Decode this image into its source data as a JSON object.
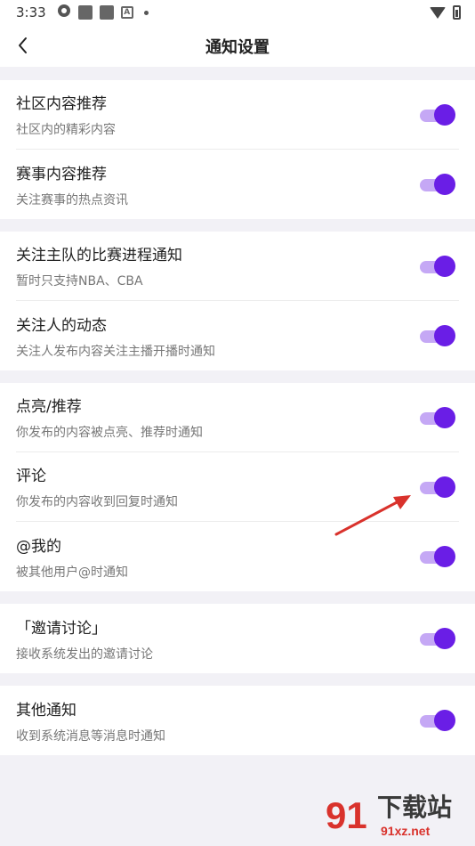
{
  "status_bar": {
    "time": "3:33"
  },
  "header": {
    "title": "通知设置"
  },
  "groups": [
    {
      "items": [
        {
          "title": "社区内容推荐",
          "subtitle": "社区内的精彩内容",
          "enabled": true
        },
        {
          "title": "赛事内容推荐",
          "subtitle": "关注赛事的热点资讯",
          "enabled": true
        }
      ]
    },
    {
      "items": [
        {
          "title": "关注主队的比赛进程通知",
          "subtitle": "暂时只支持NBA、CBA",
          "enabled": true
        },
        {
          "title": "关注人的动态",
          "subtitle": "关注人发布内容关注主播开播时通知",
          "enabled": true
        }
      ]
    },
    {
      "items": [
        {
          "title": "点亮/推荐",
          "subtitle": "你发布的内容被点亮、推荐时通知",
          "enabled": true
        },
        {
          "title": "评论",
          "subtitle": "你发布的内容收到回复时通知",
          "enabled": true
        },
        {
          "title": "@我的",
          "subtitle": "被其他用户@时通知",
          "enabled": true
        }
      ]
    },
    {
      "items": [
        {
          "title": "「邀请讨论」",
          "subtitle": "接收系统发出的邀请讨论",
          "enabled": true
        }
      ]
    },
    {
      "items": [
        {
          "title": "其他通知",
          "subtitle": "收到系统消息等消息时通知",
          "enabled": true
        }
      ]
    }
  ],
  "watermark": {
    "brand": "下载站",
    "url": "91xz.net",
    "logo_text": "91"
  },
  "colors": {
    "toggle_knob": "#6a1ee6",
    "toggle_track": "#c5a8f5",
    "annotation_arrow": "#d9322c"
  }
}
